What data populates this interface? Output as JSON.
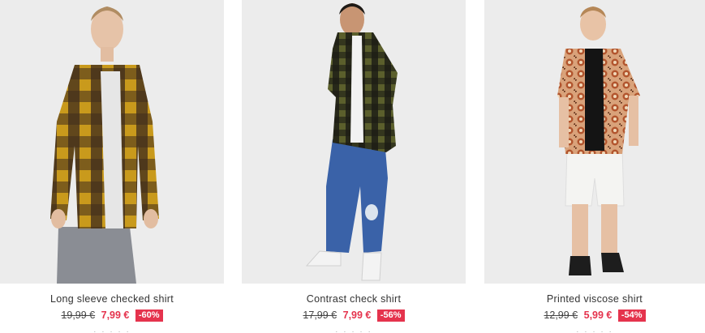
{
  "products": [
    {
      "name": "Long sleeve checked shirt",
      "old_price": "19,99 €",
      "new_price": "7,99 €",
      "discount": "-60%",
      "image_icon": "product-photo-checked-shirt"
    },
    {
      "name": "Contrast check shirt",
      "old_price": "17,99 €",
      "new_price": "7,99 €",
      "discount": "-56%",
      "image_icon": "product-photo-contrast-check-shirt"
    },
    {
      "name": "Printed viscose shirt",
      "old_price": "12,99 €",
      "new_price": "5,99 €",
      "discount": "-54%",
      "image_icon": "product-photo-printed-viscose-shirt"
    }
  ],
  "colors": {
    "sale_red": "#e5334d",
    "photo_bg": "#ececec"
  }
}
